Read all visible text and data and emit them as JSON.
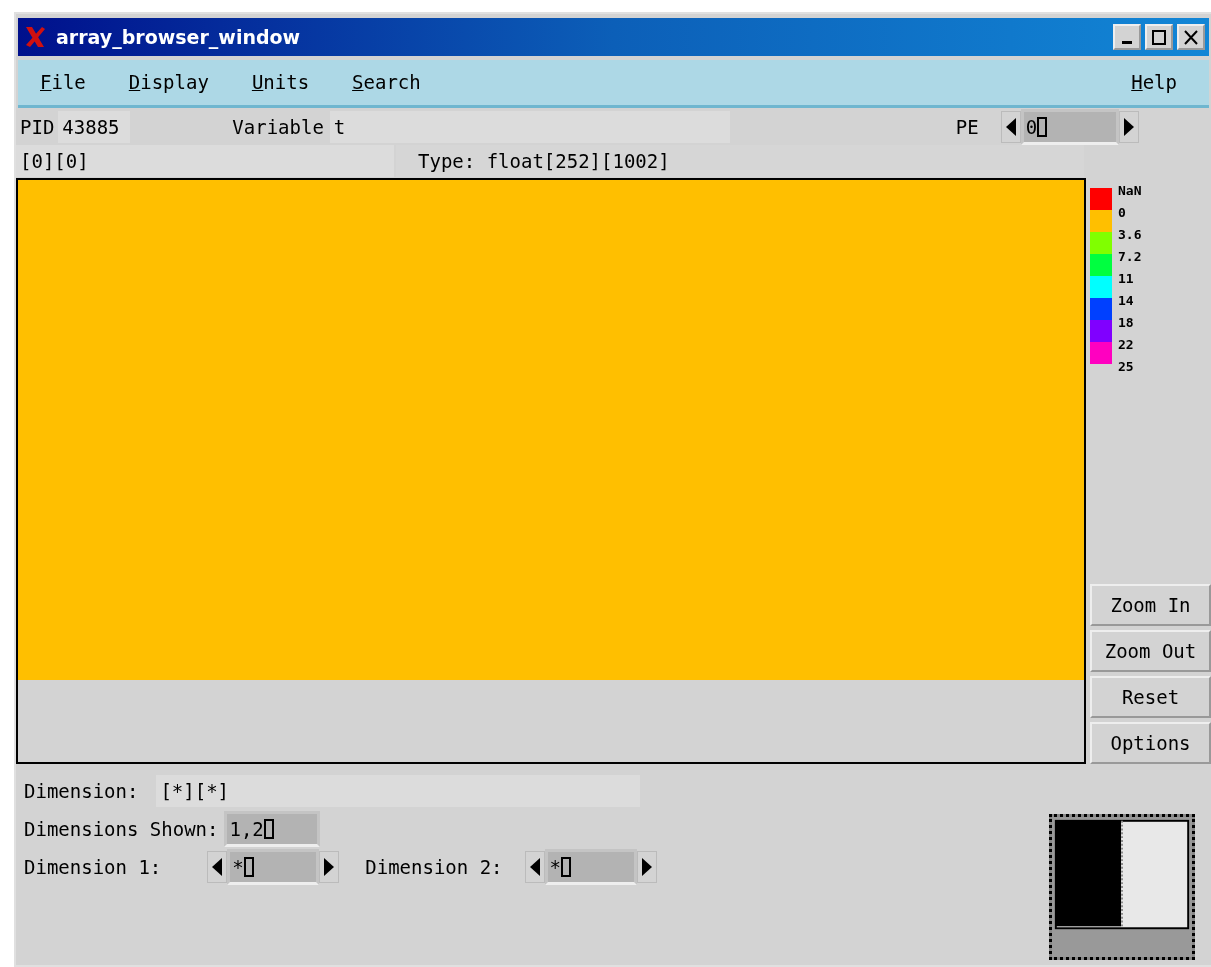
{
  "window": {
    "title": "array_browser_window"
  },
  "menu": [
    {
      "label": "File"
    },
    {
      "label": "Display"
    },
    {
      "label": "Units"
    },
    {
      "label": "Search"
    }
  ],
  "help_menu": {
    "label": "Help"
  },
  "info": {
    "pid_label": "PID",
    "pid": "43885",
    "variable_label": "Variable",
    "variable": "t",
    "pe_label": "PE",
    "pe_value": "0",
    "index": "[0][0]",
    "type": "Type: float[252][1002]"
  },
  "plot": {
    "color": "#ffbf00"
  },
  "legend": {
    "labels": [
      "NaN",
      "0",
      "3.6",
      "7.2",
      "11",
      "14",
      "18",
      "22",
      "25"
    ],
    "swatches": [
      {
        "color": "#ff0000"
      },
      {
        "color": "#ffbf00"
      },
      {
        "color": "#80ff00"
      },
      {
        "color": "#00ff40"
      },
      {
        "color": "#00ffff"
      },
      {
        "color": "#0040ff"
      },
      {
        "color": "#8000ff"
      },
      {
        "color": "#ff00c0"
      }
    ]
  },
  "buttons": [
    "Zoom In",
    "Zoom Out",
    "Reset",
    "Options"
  ],
  "dimension": {
    "label": "Dimension:",
    "value": "[*][*]"
  },
  "dimensions_shown": {
    "label": "Dimensions Shown:",
    "value": "1,2"
  },
  "dimension_spinners": [
    {
      "label": "Dimension 1:",
      "value": "*"
    },
    {
      "label": "Dimension 2:",
      "value": "*"
    }
  ]
}
